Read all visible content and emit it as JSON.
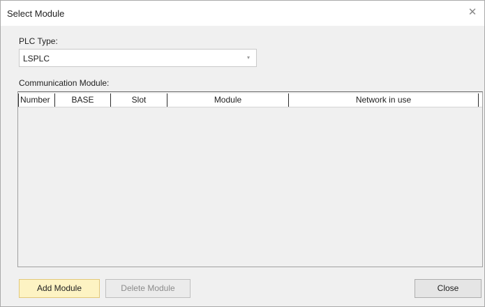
{
  "window": {
    "title": "Select Module",
    "close_glyph": "✕"
  },
  "plc_type": {
    "label": "PLC Type:",
    "value": "LSPLC",
    "arrow_glyph": "▾"
  },
  "comm_module": {
    "label": "Communication Module:",
    "columns": [
      "Number",
      "BASE",
      "Slot",
      "Module",
      "Network in use"
    ],
    "rows": []
  },
  "buttons": {
    "add": "Add Module",
    "delete": "Delete Module",
    "close": "Close"
  }
}
